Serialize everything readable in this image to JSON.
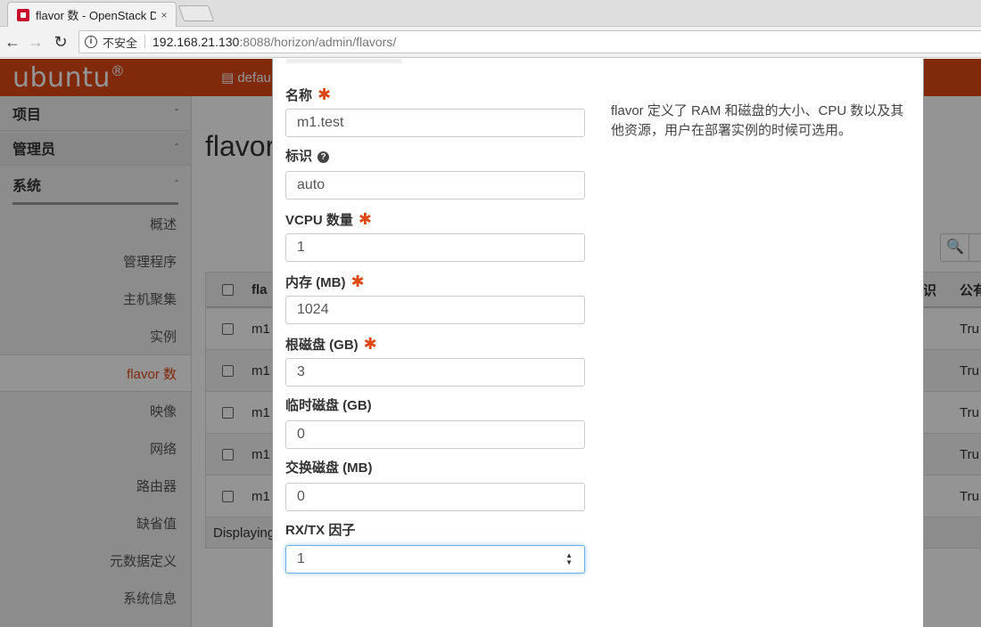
{
  "browser": {
    "tab_title": "flavor 数 - OpenStack D",
    "tab_close": "×",
    "back": "←",
    "forward": "→",
    "reload": "↻",
    "info": "i",
    "insecure_label": "不安全",
    "url_host": "192.168.21.130",
    "url_rest": ":8088/horizon/admin/flavors/"
  },
  "topbar": {
    "logo": "ubuntu",
    "logo_mark": "®",
    "project": "▤ defau"
  },
  "sidebar": {
    "project": "项目",
    "admin": "管理员",
    "system": "系统",
    "chev_down": "ˇ",
    "chev_up": "ˆ",
    "items": [
      "概述",
      "管理程序",
      "主机聚集",
      "实例",
      "flavor 数",
      "映像",
      "网络",
      "路由器",
      "缺省值",
      "元数据定义",
      "系统信息"
    ]
  },
  "content": {
    "page_title": "flavor",
    "search_icon": "🔍",
    "header_col": "fla",
    "header_ident": "识",
    "header_public": "公有",
    "rows": [
      {
        "name": "m1",
        "public": "Tru"
      },
      {
        "name": "m1",
        "public": "Tru"
      },
      {
        "name": "m1",
        "public": "Tru"
      },
      {
        "name": "m1",
        "public": "Tru"
      },
      {
        "name": "m1",
        "public": "Tru"
      }
    ],
    "footer": "Displaying"
  },
  "modal": {
    "required_mark": "✱",
    "help_mark": "?",
    "fields": {
      "name": {
        "label": "名称",
        "value": "m1.test"
      },
      "id": {
        "label": "标识",
        "value": "auto"
      },
      "vcpus": {
        "label": "VCPU 数量",
        "value": "1"
      },
      "ram": {
        "label": "内存 (MB)",
        "value": "1024"
      },
      "disk": {
        "label": "根磁盘 (GB)",
        "value": "3"
      },
      "ephemeral": {
        "label": "临时磁盘 (GB)",
        "value": "0"
      },
      "swap": {
        "label": "交换磁盘 (MB)",
        "value": "0"
      },
      "rxtx": {
        "label": "RX/TX 因子",
        "value": "1"
      }
    },
    "spin_up": "▲",
    "spin_down": "▼",
    "description": "flavor 定义了 RAM 和磁盘的大小、CPU 数以及其他资源，用户在部署实例的时候可选用。"
  }
}
